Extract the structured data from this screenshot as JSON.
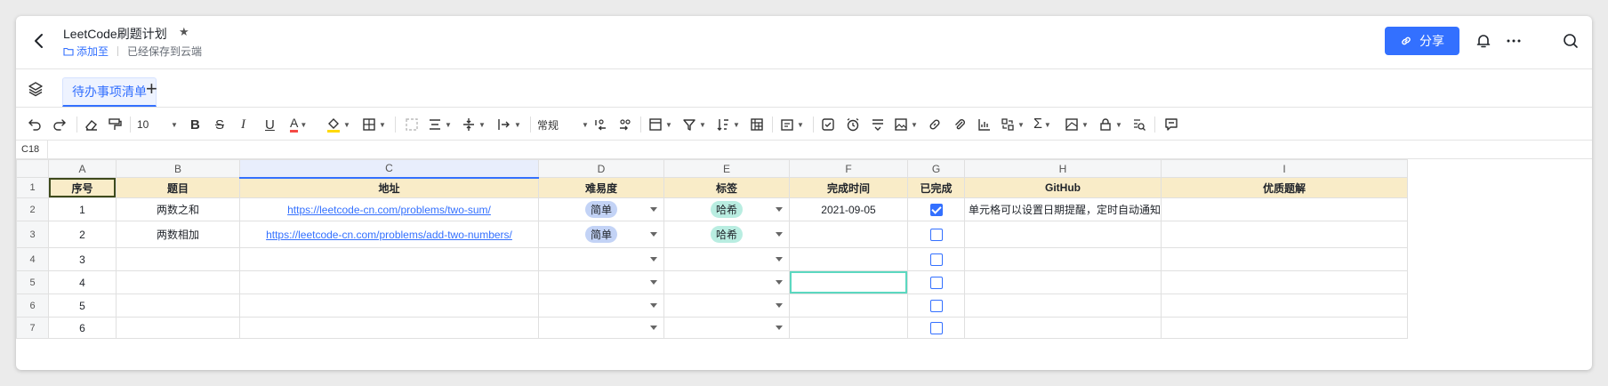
{
  "header": {
    "title": "LeetCode刷题计划",
    "add_to": "添加至",
    "saved": "已经保存到云端",
    "share_label": "分享"
  },
  "sheet_tab": "待办事项清单",
  "toolbar": {
    "font_size": "10",
    "number_format": "常规"
  },
  "cell_ref": "C18",
  "columns": [
    "A",
    "B",
    "C",
    "D",
    "E",
    "F",
    "G",
    "H",
    "I"
  ],
  "table_headers": [
    "序号",
    "题目",
    "地址",
    "难易度",
    "标签",
    "完成时间",
    "已完成",
    "GitHub",
    "优质题解"
  ],
  "rows": [
    {
      "num": "2",
      "idx": "1",
      "title": "两数之和",
      "url": "https://leetcode-cn.com/problems/two-sum/",
      "difficulty": "简单",
      "tag": "哈希",
      "date": "2021-09-05",
      "done": true,
      "github": "单元格可以设置日期提醒，定时自动通知"
    },
    {
      "num": "3",
      "idx": "2",
      "title": "两数相加",
      "url": "https://leetcode-cn.com/problems/add-two-numbers/",
      "difficulty": "简单",
      "tag": "哈希",
      "date": "",
      "done": false,
      "github": ""
    },
    {
      "num": "4",
      "idx": "3",
      "title": "",
      "url": "",
      "difficulty": "",
      "tag": "",
      "date": "",
      "done": false,
      "github": ""
    },
    {
      "num": "5",
      "idx": "4",
      "title": "",
      "url": "",
      "difficulty": "",
      "tag": "",
      "date": "",
      "done": false,
      "github": ""
    },
    {
      "num": "6",
      "idx": "5",
      "title": "",
      "url": "",
      "difficulty": "",
      "tag": "",
      "date": "",
      "done": false,
      "github": ""
    },
    {
      "num": "7",
      "idx": "6",
      "title": "",
      "url": "",
      "difficulty": "",
      "tag": "",
      "date": "",
      "done": false,
      "github": ""
    }
  ],
  "header_row_num": "1",
  "colors": {
    "accent": "#3370ff",
    "header_fill": "#f9ecc8",
    "pill_easy": "#c3d3f6",
    "pill_hash": "#b9ede1"
  }
}
